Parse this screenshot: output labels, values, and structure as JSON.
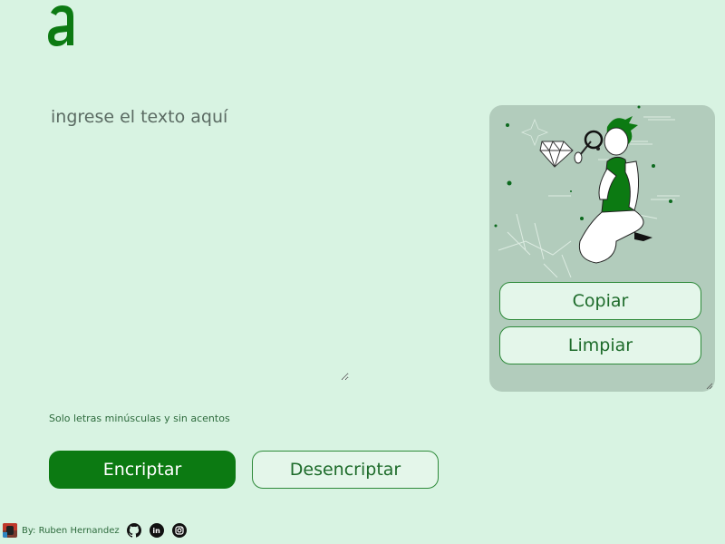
{
  "brand": {
    "logo_letter": "a",
    "color": "#0c7a12"
  },
  "editor": {
    "placeholder": "ingrese el texto aquí"
  },
  "hint": {
    "text": "Solo letras minúsculas y sin acentos"
  },
  "actions": {
    "encrypt_label": "Encriptar",
    "decrypt_label": "Desencriptar"
  },
  "output_panel": {
    "copy_label": "Copiar",
    "clear_label": "Limpiar"
  },
  "footer": {
    "author": "By: Ruben Hernandez",
    "social": [
      {
        "name": "github-icon"
      },
      {
        "name": "linkedin-icon",
        "glyph": "in"
      },
      {
        "name": "instagram-icon"
      }
    ]
  },
  "colors": {
    "background": "#d8f3e2",
    "accent": "#0c7a12",
    "panel": "#b2ccbc",
    "secondary_button": "#e4f6ea"
  }
}
